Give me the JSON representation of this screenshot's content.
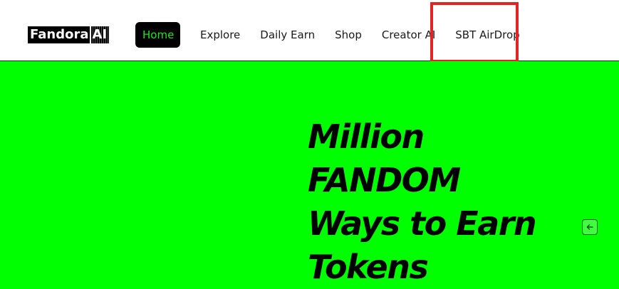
{
  "header": {
    "logo": {
      "main": "Fandora",
      "ai": "AI"
    },
    "nav": [
      {
        "label": "Home",
        "active": true
      },
      {
        "label": "Explore"
      },
      {
        "label": "Daily Earn"
      },
      {
        "label": "Shop"
      },
      {
        "label": "Creator AI"
      },
      {
        "label": "SBT AirDrop",
        "highlighted": true
      }
    ]
  },
  "hero": {
    "headline_lines": [
      "Million",
      "FANDOM",
      "Ways to Earn",
      "Tokens"
    ],
    "slider_button_icon": "arrow-left-icon"
  },
  "colors": {
    "hero_background": "#00ff00",
    "home_active_text": "#22e51c",
    "highlight_border": "#e42424"
  }
}
